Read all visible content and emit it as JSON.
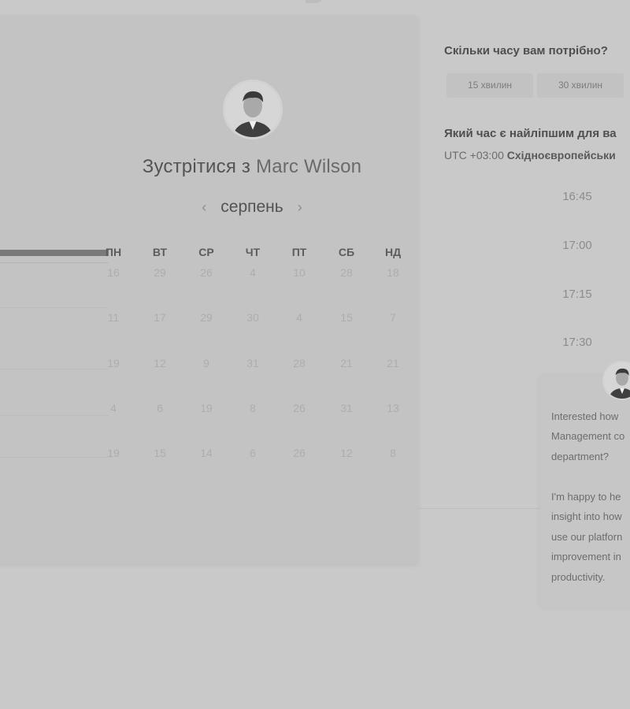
{
  "host": {
    "meet_prefix": "Зустрітися з ",
    "name": "Marc Wilson"
  },
  "calendar": {
    "month": "серпень",
    "weekdays": [
      "ПН",
      "ВТ",
      "СР",
      "ЧТ",
      "ПТ",
      "СБ",
      "НД"
    ],
    "weeks": [
      [
        "16",
        "29",
        "26",
        "4",
        "10",
        "28",
        "18"
      ],
      [
        "11",
        "17",
        "29",
        "30",
        "4",
        "15",
        "7"
      ],
      [
        "19",
        "12",
        "9",
        "31",
        "28",
        "21",
        "21"
      ],
      [
        "4",
        "6",
        "19",
        "8",
        "26",
        "31",
        "13"
      ],
      [
        "19",
        "15",
        "14",
        "6",
        "26",
        "12",
        "8"
      ]
    ]
  },
  "duration": {
    "question": "Скільки часу вам потрібно?",
    "options": [
      "15 хвилин",
      "30 хвилин"
    ]
  },
  "time": {
    "question": "Який час є найліпшим для ва",
    "tz_offset": "UTC +03:00",
    "tz_name": "Східноєвропейськи",
    "slots": [
      "16:45",
      "17:00",
      "17:15",
      "17:30"
    ]
  },
  "message": {
    "lines": [
      "Interested how",
      "Management co",
      "department?",
      "",
      "I'm happy to he",
      "insight into how",
      "use our platforn",
      "improvement in",
      "productivity."
    ]
  }
}
